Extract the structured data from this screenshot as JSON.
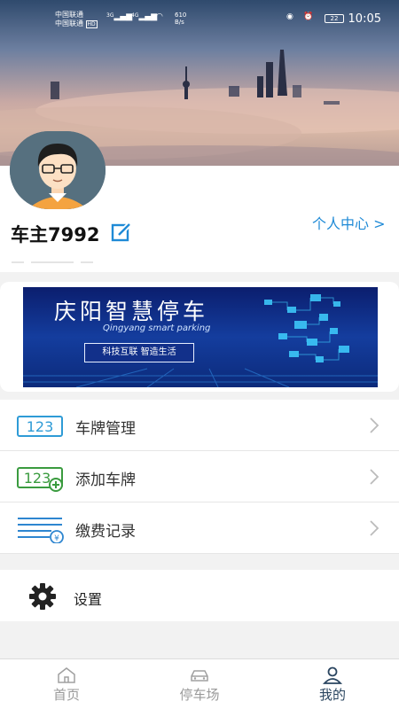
{
  "status_bar": {
    "carrier_1": "中国联通",
    "carrier_2": "中国联通",
    "hd": "HD",
    "net_1": "3G",
    "net_2": "4G",
    "speed": "610",
    "speed_unit": "B/s",
    "battery": "22",
    "time": "10:05"
  },
  "profile": {
    "username": "车主7992",
    "personal_center": "个人中心 >"
  },
  "banner": {
    "title": "庆阳智慧停车",
    "subtitle": "Qingyang smart parking",
    "tagline": "科技互联 智造生活"
  },
  "menu": {
    "items": [
      {
        "label": "车牌管理",
        "icon": "plate-123-icon"
      },
      {
        "label": "添加车牌",
        "icon": "add-plate-icon"
      },
      {
        "label": "缴费记录",
        "icon": "payment-record-icon"
      }
    ],
    "settings_label": "设置"
  },
  "bottom_nav": {
    "items": [
      {
        "label": "首页",
        "icon": "home-icon"
      },
      {
        "label": "停车场",
        "icon": "car-icon"
      },
      {
        "label": "我的",
        "icon": "user-icon"
      }
    ],
    "active_index": 2
  },
  "colors": {
    "accent": "#1f8ad6",
    "nav_active": "#2a4560",
    "plate_blue": "#2e9bd6",
    "plate_green": "#3a9b3f"
  }
}
